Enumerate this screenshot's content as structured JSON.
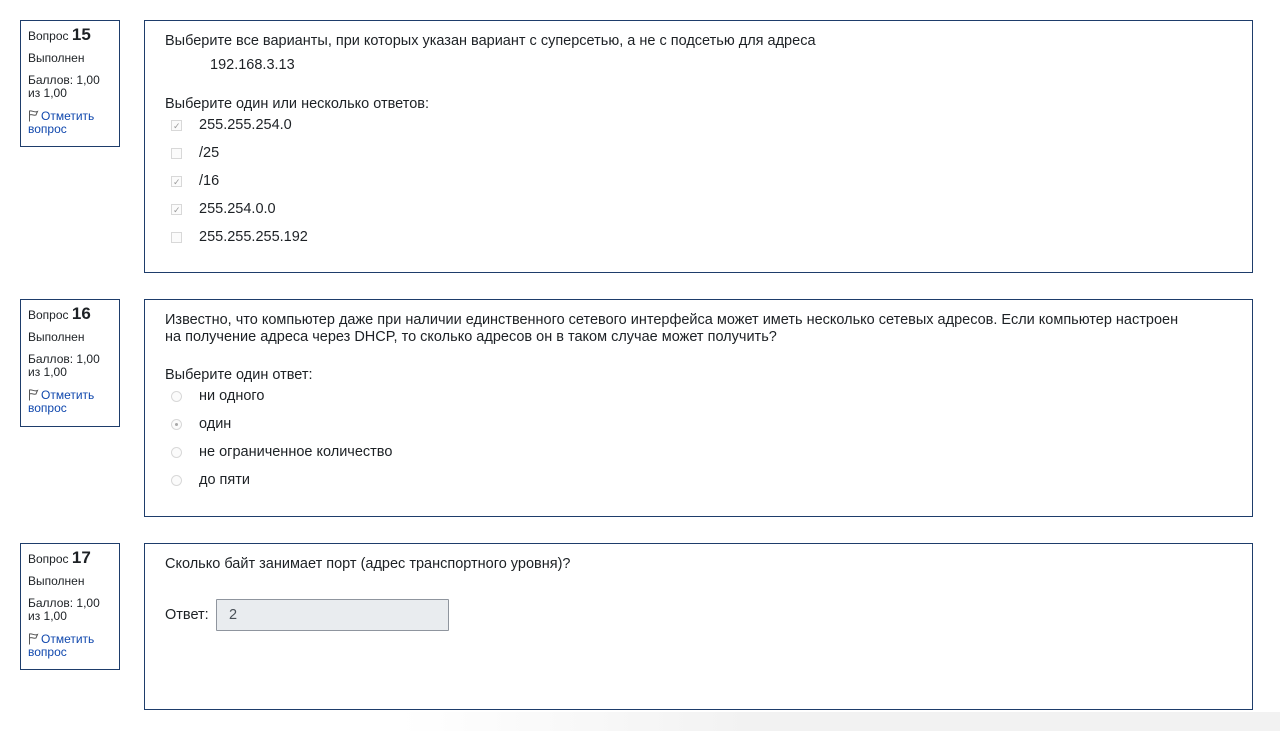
{
  "questions": [
    {
      "number_label": "Вопрос",
      "number": "15",
      "state": "Выполнен",
      "grade_line1": "Баллов: 1,00",
      "grade_line2": "из 1,00",
      "flag_line1": "Отметить",
      "flag_line2": "вопрос",
      "text": "Выберите все варианты, при которых указан вариант с суперсетью, а не с подсетью для адреса",
      "address": "192.168.3.13",
      "prompt": "Выберите один или несколько ответов:",
      "input_type": "checkbox",
      "options": [
        {
          "label": "255.255.254.0",
          "checked": true
        },
        {
          "label": "/25",
          "checked": false
        },
        {
          "label": "/16",
          "checked": true
        },
        {
          "label": "255.254.0.0",
          "checked": true
        },
        {
          "label": "255.255.255.192",
          "checked": false
        }
      ]
    },
    {
      "number_label": "Вопрос",
      "number": "16",
      "state": "Выполнен",
      "grade_line1": "Баллов: 1,00",
      "grade_line2": "из 1,00",
      "flag_line1": "Отметить",
      "flag_line2": "вопрос",
      "text_line1": "Известно, что компьютер даже при наличии единственного сетевого интерфейса может иметь несколько сетевых адресов. Если компьютер настроен",
      "text_line2": "на получение адреса через DHCP, то сколько адресов он в таком случае может получить?",
      "prompt": "Выберите один ответ:",
      "input_type": "radio",
      "options": [
        {
          "label": "ни одного",
          "checked": false
        },
        {
          "label": "один",
          "checked": true
        },
        {
          "label": "не ограниченное количество",
          "checked": false
        },
        {
          "label": "до пяти",
          "checked": false
        }
      ]
    },
    {
      "number_label": "Вопрос",
      "number": "17",
      "state": "Выполнен",
      "grade_line1": "Баллов: 1,00",
      "grade_line2": "из 1,00",
      "flag_line1": "Отметить",
      "flag_line2": "вопрос",
      "text": "Сколько байт занимает порт (адрес транспортного уровня)?",
      "answer_label": "Ответ:",
      "answer_value": "2"
    }
  ],
  "icons": {
    "flag": "flag-icon",
    "check": "checkmark-icon"
  },
  "colors": {
    "border": "#1e3d6b",
    "link": "#0f47ad",
    "input_bg": "#e9ecef"
  }
}
